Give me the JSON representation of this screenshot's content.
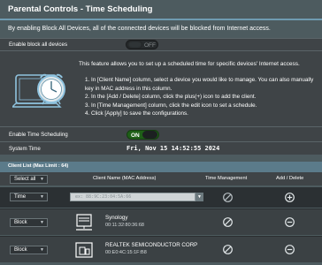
{
  "header": {
    "title": "Parental Controls - Time Scheduling",
    "description": "By enabling Block All Devices, all of the connected devices will be blocked from Internet access."
  },
  "block_all": {
    "label": "Enable block all devices",
    "state_label": "OFF"
  },
  "info": {
    "headline": "This feature allows you to set up a scheduled time for specific devices' Internet access.",
    "steps": [
      "1. In [Client Name] column, select a device you would like to manage. You can also manually key in MAC address in this column.",
      "2. In the [Add / Delete] column, click the plus(+) icon to add the client.",
      "3. In [Time Management] column, click the edit icon to set a schedule.",
      "4. Click [Apply] to save the configurations."
    ],
    "illustration_icon": "clock-and-computer-icon"
  },
  "time_scheduling": {
    "label": "Enable Time Scheduling",
    "state_label": "ON"
  },
  "system_time": {
    "label": "System Time",
    "value": "Fri, Nov 15 14:52:55 2024"
  },
  "client_list": {
    "title": "Client List (Max Limit : 64)",
    "select_all": "Select all",
    "columns": {
      "client_name": "Client Name (MAC Address)",
      "time_management": "Time Management",
      "add_delete": "Add / Delete"
    },
    "new_entry": {
      "mode": "Time",
      "mac_placeholder": "ex: 88:9C:23:04:5A:66"
    },
    "clients": [
      {
        "mode": "Block",
        "name": "Synology",
        "mac": "00:11:32:80:36:68",
        "icon": "nas-server-icon"
      },
      {
        "mode": "Block",
        "name": "REALTEK SEMICONDUCTOR CORP",
        "mac": "00:E0:4C:15:1F:B8",
        "icon": "computer-icon"
      }
    ]
  },
  "colors": {
    "background": "#4d5b5f",
    "panel": "#3f4447",
    "accent_rule": "#6f9bb1",
    "toggle_on": "#1e5f17"
  }
}
